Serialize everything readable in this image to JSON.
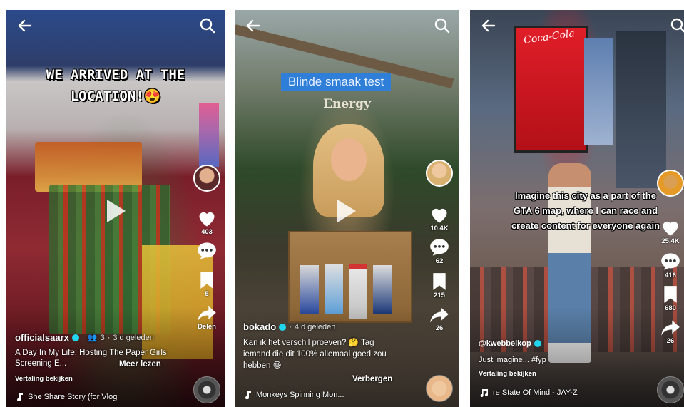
{
  "screens": [
    {
      "overlay_title": "WE ARRIVED AT THE LOCATION!😍",
      "likes": "403",
      "comments": "",
      "saves": "5",
      "share_label": "Delen",
      "username": "officialsaarx",
      "followers": "3",
      "time": "3 d geleden",
      "caption": "A Day In My Life: Hosting The Paper Girls Screening E...",
      "more": "Meer lezen",
      "translate": "Vertaling bekijken",
      "music": "She Share Story (for Vlog"
    },
    {
      "overlay_title": "Blinde smaak test",
      "overlay_sub": "Energy",
      "likes": "10.4K",
      "comments": "62",
      "saves": "215",
      "shares": "26",
      "username": "bokado",
      "time": "4 d geleden",
      "caption": "Kan ik het verschil proeven? 🤔 Tag iemand die dit 100% allemaal goed zou hebben 😆",
      "hide": "Verbergen",
      "music": "Monkeys Spinning Mon..."
    },
    {
      "overlay_caption": "Imagine this city as a part of the GTA 6 map, where I can race and create content for everyone again",
      "likes": "25.4K",
      "comments": "416",
      "saves": "680",
      "shares": "26",
      "username": "@kwebbelkop",
      "caption": "Just imagine... #fyp",
      "translate": "Vertaling bekijken",
      "music": "re State Of Mind - JAY-Z"
    }
  ],
  "icons": [
    "back-arrow-icon",
    "search-icon",
    "play-icon",
    "heart-icon",
    "comment-icon",
    "bookmark-icon",
    "share-icon",
    "music-note-icon",
    "verified-icon"
  ],
  "colors": {
    "verified": "#20d5ec",
    "tag_bg": "#2f7fd8",
    "like": "#ffffff"
  }
}
